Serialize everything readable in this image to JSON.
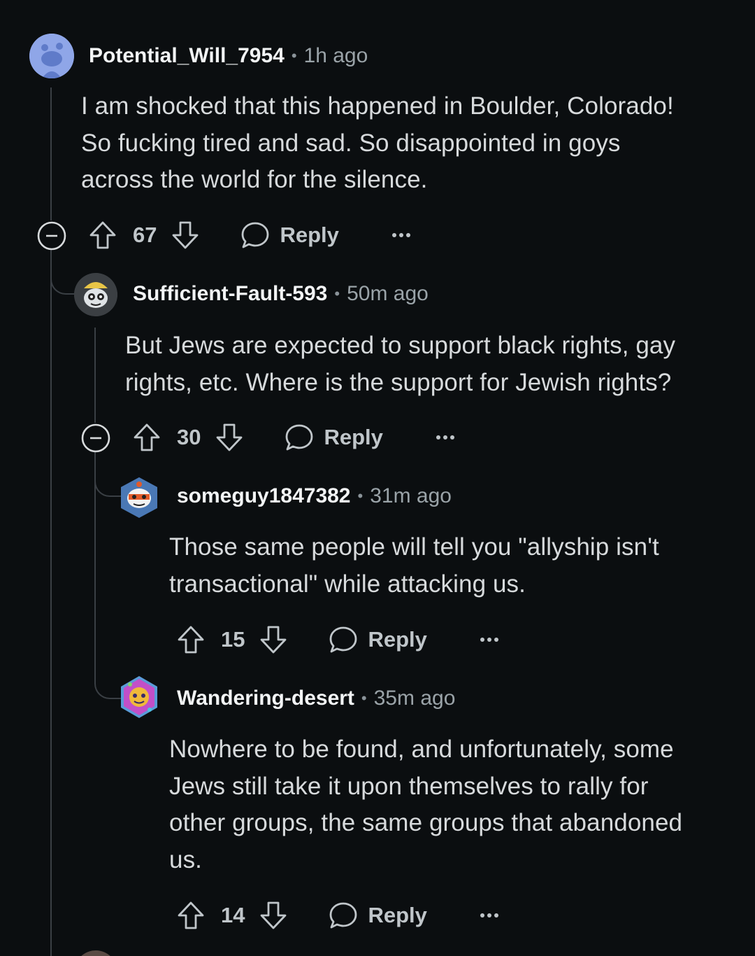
{
  "comments": [
    {
      "username": "Potential_Will_7954",
      "time": "1h ago",
      "body_lines": [
        "I am shocked that this happened in Boulder, Colorado!",
        "So fucking tired and sad. So disappointed in goys",
        "across the world for the silence."
      ],
      "votes": "67",
      "reply_label": "Reply",
      "avatar_icon": "reddit-snoo-default-icon"
    },
    {
      "username": "Sufficient-Fault-593",
      "time": "50m ago",
      "body_lines": [
        "But Jews are expected to support black rights, gay",
        "rights, etc. Where is the support for Jewish rights?"
      ],
      "votes": "30",
      "reply_label": "Reply",
      "avatar_icon": "snoo-avatar-icon"
    },
    {
      "username": "someguy1847382",
      "time": "31m ago",
      "body_lines": [
        "Those same people will tell you \"allyship isn't",
        "transactional\" while attacking us."
      ],
      "votes": "15",
      "reply_label": "Reply",
      "avatar_icon": "snoo-avatar-icon"
    },
    {
      "username": "Wandering-desert",
      "time": "35m ago",
      "body_lines": [
        "Nowhere to be found, and unfortunately, some",
        "Jews still take it upon themselves to rally for",
        "other groups, the same groups that abandoned",
        "us."
      ],
      "votes": "14",
      "reply_label": "Reply",
      "avatar_icon": "snoo-avatar-icon"
    }
  ],
  "separator": "•",
  "colors": {
    "background": "#0b0e10",
    "text": "#d7dadc",
    "username": "#f2f4f5",
    "muted": "#9aa3a8",
    "thread_line": "#3a3f44"
  }
}
